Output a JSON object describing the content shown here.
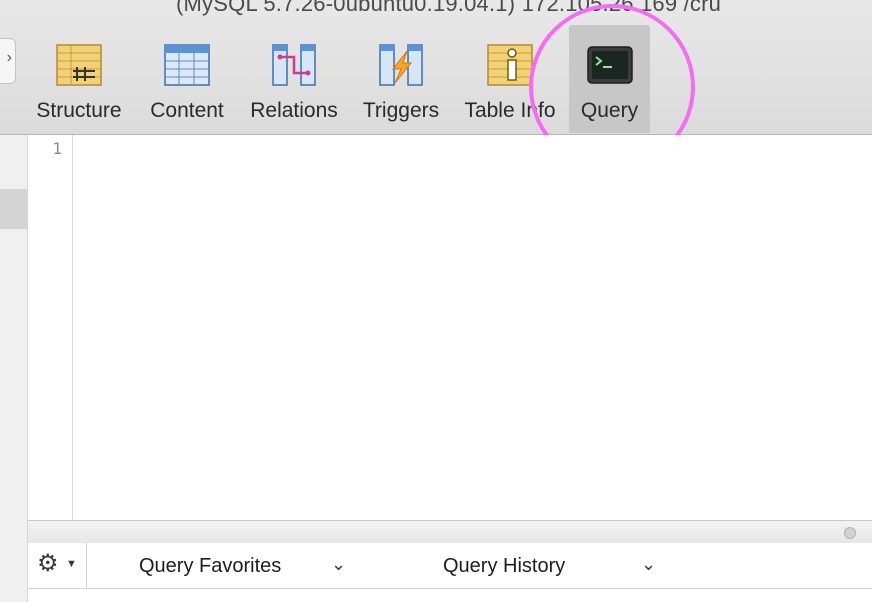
{
  "window": {
    "title": "(MySQL 5.7.26-0ubuntu0.19.04.1) 172.105.26.169 /cru"
  },
  "toolbar": {
    "items": [
      {
        "label": "Structure",
        "icon": "structure-icon"
      },
      {
        "label": "Content",
        "icon": "content-icon"
      },
      {
        "label": "Relations",
        "icon": "relations-icon"
      },
      {
        "label": "Triggers",
        "icon": "triggers-icon"
      },
      {
        "label": "Table Info",
        "icon": "table-info-icon"
      },
      {
        "label": "Query",
        "icon": "query-terminal-icon",
        "active": true
      }
    ]
  },
  "editor": {
    "line_numbers": [
      "1"
    ],
    "content": ""
  },
  "bottom_bar": {
    "gear_icon": "gear-icon",
    "favorites_label": "Query Favorites",
    "history_label": "Query History"
  },
  "colors": {
    "highlight_circle": "#f46cf0",
    "toolbar_bg": "#e2e1e2",
    "active_tab_bg": "#c8c7c8"
  }
}
